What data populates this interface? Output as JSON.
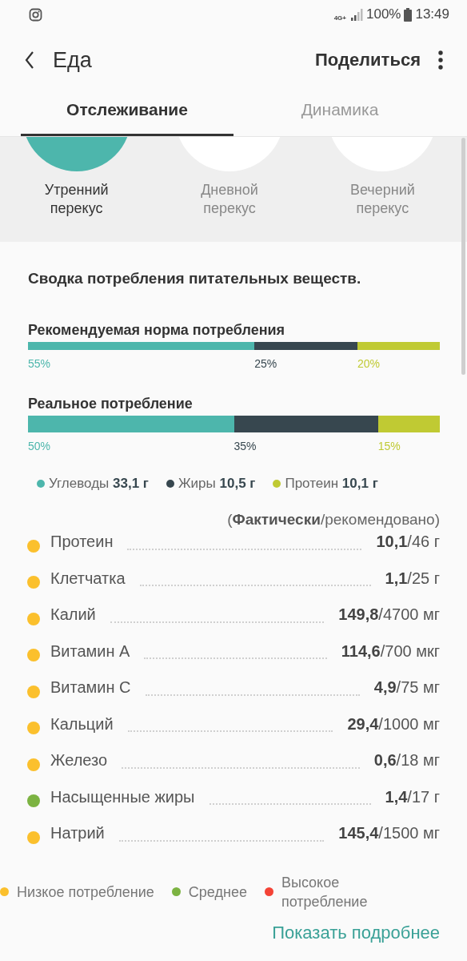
{
  "status_bar": {
    "network": "4G+",
    "battery": "100%",
    "time": "13:49"
  },
  "app_bar": {
    "title": "Еда",
    "action": "Поделиться"
  },
  "tabs": [
    {
      "label": "Отслеживание",
      "selected": true
    },
    {
      "label": "Динамика",
      "selected": false
    }
  ],
  "meals": [
    {
      "label": "Утренний перекус",
      "selected": true
    },
    {
      "label": "Дневной перекус",
      "selected": false
    },
    {
      "label": "Вечерний перекус",
      "selected": false
    }
  ],
  "summary": {
    "title": "Сводка потребления питательных веществ.",
    "bars": [
      {
        "kind": "thin",
        "title": "Рекомендуемая норма потребления",
        "segments": [
          {
            "label": "55%",
            "color": "#4db6ac"
          },
          {
            "label": "25%",
            "color": "#37474f"
          },
          {
            "label": "20%",
            "color": "#c0ca33"
          }
        ]
      },
      {
        "kind": "thick",
        "title": "Реальное потребление",
        "segments": [
          {
            "label": "50%",
            "color": "#4db6ac"
          },
          {
            "label": "35%",
            "color": "#37474f"
          },
          {
            "label": "15%",
            "color": "#c0ca33"
          }
        ]
      }
    ],
    "legend": [
      {
        "text": "Углеводы **33,1 г**",
        "color": "#4db6ac"
      },
      {
        "text": "Жиры **10,5 г**",
        "color": "#37474f"
      },
      {
        "text": "Протеин **10,1 г**",
        "color": "#c0ca33"
      }
    ]
  },
  "nutrients": {
    "note": "(**Фактически**/рекомендовано)",
    "rows": [
      {
        "name": "Протеин",
        "value": "**10,1**/46 г",
        "color": "#fbc02d"
      },
      {
        "name": "Клетчатка",
        "value": "**1,1**/25 г",
        "color": "#fbc02d"
      },
      {
        "name": "Калий",
        "value": "**149,8**/4700 мг",
        "color": "#fbc02d"
      },
      {
        "name": "Витамин A",
        "value": "**114,6**/700 мкг",
        "color": "#fbc02d"
      },
      {
        "name": "Витамин C",
        "value": "**4,9**/75 мг",
        "color": "#fbc02d"
      },
      {
        "name": "Кальций",
        "value": "**29,4**/1000 мг",
        "color": "#fbc02d"
      },
      {
        "name": "Железо",
        "value": "**0,6**/18 мг",
        "color": "#fbc02d"
      },
      {
        "name": "Насыщенные жиры",
        "value": "**1,4**/17 г",
        "color": "#7cb342"
      },
      {
        "name": "Натрий",
        "value": "**145,4**/1500 мг",
        "color": "#fbc02d"
      }
    ]
  },
  "intake_legend": [
    {
      "label": "Низкое потребление",
      "color": "#fbc02d"
    },
    {
      "label": "Среднее",
      "color": "#7cb342"
    },
    {
      "label": "Высокое потребление",
      "color": "#f44336"
    }
  ],
  "link": "Показать подробнее"
}
